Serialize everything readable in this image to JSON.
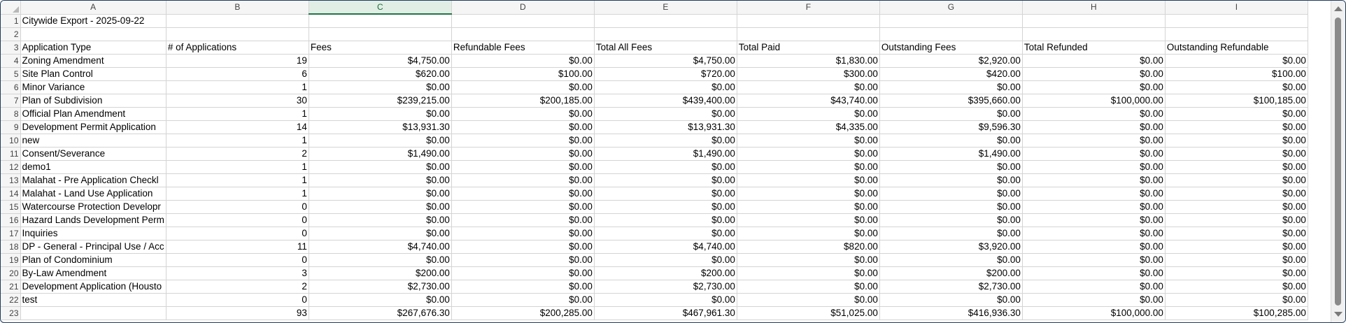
{
  "columns": [
    "A",
    "B",
    "C",
    "D",
    "E",
    "F",
    "G",
    "H",
    "I"
  ],
  "selected_column": "C",
  "rows": [
    {
      "n": "1",
      "cells": [
        "Citywide Export - 2025-09-22",
        "",
        "",
        "",
        "",
        "",
        "",
        "",
        ""
      ]
    },
    {
      "n": "2",
      "cells": [
        "",
        "",
        "",
        "",
        "",
        "",
        "",
        "",
        ""
      ]
    },
    {
      "n": "3",
      "cells": [
        "Application Type",
        "# of Applications",
        "Fees",
        "Refundable Fees",
        "Total All Fees",
        "Total Paid",
        "Outstanding Fees",
        "Total Refunded",
        "Outstanding Refundable"
      ]
    },
    {
      "n": "4",
      "cells": [
        "Zoning Amendment",
        "19",
        "$4,750.00",
        "$0.00",
        "$4,750.00",
        "$1,830.00",
        "$2,920.00",
        "$0.00",
        "$0.00"
      ]
    },
    {
      "n": "5",
      "cells": [
        "Site Plan Control",
        "6",
        "$620.00",
        "$100.00",
        "$720.00",
        "$300.00",
        "$420.00",
        "$0.00",
        "$100.00"
      ]
    },
    {
      "n": "6",
      "cells": [
        "Minor Variance",
        "1",
        "$0.00",
        "$0.00",
        "$0.00",
        "$0.00",
        "$0.00",
        "$0.00",
        "$0.00"
      ]
    },
    {
      "n": "7",
      "cells": [
        "Plan of Subdivision",
        "30",
        "$239,215.00",
        "$200,185.00",
        "$439,400.00",
        "$43,740.00",
        "$395,660.00",
        "$100,000.00",
        "$100,185.00"
      ]
    },
    {
      "n": "8",
      "cells": [
        "Official Plan Amendment",
        "1",
        "$0.00",
        "$0.00",
        "$0.00",
        "$0.00",
        "$0.00",
        "$0.00",
        "$0.00"
      ]
    },
    {
      "n": "9",
      "cells": [
        "Development Permit Application",
        "14",
        "$13,931.30",
        "$0.00",
        "$13,931.30",
        "$4,335.00",
        "$9,596.30",
        "$0.00",
        "$0.00"
      ]
    },
    {
      "n": "10",
      "cells": [
        "new",
        "1",
        "$0.00",
        "$0.00",
        "$0.00",
        "$0.00",
        "$0.00",
        "$0.00",
        "$0.00"
      ]
    },
    {
      "n": "11",
      "cells": [
        "Consent/Severance",
        "2",
        "$1,490.00",
        "$0.00",
        "$1,490.00",
        "$0.00",
        "$1,490.00",
        "$0.00",
        "$0.00"
      ]
    },
    {
      "n": "12",
      "cells": [
        "demo1",
        "1",
        "$0.00",
        "$0.00",
        "$0.00",
        "$0.00",
        "$0.00",
        "$0.00",
        "$0.00"
      ]
    },
    {
      "n": "13",
      "cells": [
        "Malahat - Pre Application Checkl",
        "1",
        "$0.00",
        "$0.00",
        "$0.00",
        "$0.00",
        "$0.00",
        "$0.00",
        "$0.00"
      ]
    },
    {
      "n": "14",
      "cells": [
        "Malahat - Land Use Application",
        "1",
        "$0.00",
        "$0.00",
        "$0.00",
        "$0.00",
        "$0.00",
        "$0.00",
        "$0.00"
      ]
    },
    {
      "n": "15",
      "cells": [
        "Watercourse Protection Developr",
        "0",
        "$0.00",
        "$0.00",
        "$0.00",
        "$0.00",
        "$0.00",
        "$0.00",
        "$0.00"
      ]
    },
    {
      "n": "16",
      "cells": [
        "Hazard Lands Development Perm",
        "0",
        "$0.00",
        "$0.00",
        "$0.00",
        "$0.00",
        "$0.00",
        "$0.00",
        "$0.00"
      ]
    },
    {
      "n": "17",
      "cells": [
        "Inquiries",
        "0",
        "$0.00",
        "$0.00",
        "$0.00",
        "$0.00",
        "$0.00",
        "$0.00",
        "$0.00"
      ]
    },
    {
      "n": "18",
      "cells": [
        "DP - General - Principal Use / Acc",
        "11",
        "$4,740.00",
        "$0.00",
        "$4,740.00",
        "$820.00",
        "$3,920.00",
        "$0.00",
        "$0.00"
      ]
    },
    {
      "n": "19",
      "cells": [
        "Plan of Condominium",
        "0",
        "$0.00",
        "$0.00",
        "$0.00",
        "$0.00",
        "$0.00",
        "$0.00",
        "$0.00"
      ]
    },
    {
      "n": "20",
      "cells": [
        "By-Law Amendment",
        "3",
        "$200.00",
        "$0.00",
        "$200.00",
        "$0.00",
        "$200.00",
        "$0.00",
        "$0.00"
      ]
    },
    {
      "n": "21",
      "cells": [
        "Development Application (Housto",
        "2",
        "$2,730.00",
        "$0.00",
        "$2,730.00",
        "$0.00",
        "$2,730.00",
        "$0.00",
        "$0.00"
      ]
    },
    {
      "n": "22",
      "cells": [
        "test",
        "0",
        "$0.00",
        "$0.00",
        "$0.00",
        "$0.00",
        "$0.00",
        "$0.00",
        "$0.00"
      ]
    },
    {
      "n": "23",
      "cells": [
        "",
        "93",
        "$267,676.30",
        "$200,285.00",
        "$467,961.30",
        "$51,025.00",
        "$416,936.30",
        "$100,000.00",
        "$100,285.00"
      ]
    }
  ]
}
